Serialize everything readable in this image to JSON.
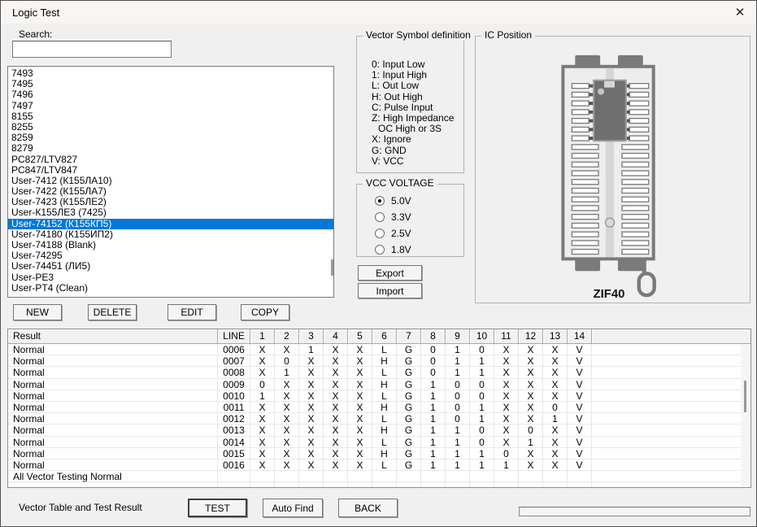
{
  "window": {
    "title": "Logic Test",
    "close_icon": "✕"
  },
  "search": {
    "label": "Search:",
    "value": ""
  },
  "chip_list": {
    "items": [
      "7493",
      "7495",
      "7496",
      "7497",
      "8155",
      "8255",
      "8259",
      "8279",
      "PC827/LTV827",
      "PC847/LTV847",
      "User-7412 (К155ЛА10)",
      "User-7422 (К155ЛА7)",
      "User-7423 (К155ЛЕ2)",
      "User-К155ЛЕ3 (7425)",
      "User-74152 (К155КП5)",
      "User-74180 (К155ИП2)",
      "User-74188 (Blank)",
      "User-74295",
      "User-74451 (ЛИ5)",
      "User-PE3",
      "User-PT4 (Clean)"
    ],
    "selected_index": 14,
    "selected_item": "User-74152 (К155КП5)"
  },
  "list_actions": {
    "new": "NEW",
    "delete": "DELETE",
    "edit": "EDIT",
    "copy": "COPY"
  },
  "vector_symbols": {
    "title": "Vector Symbol definition",
    "lines": [
      "0: Input Low",
      "1: Input High",
      "L: Out Low",
      "H: Out High",
      "C: Pulse Input",
      "Z: High Impedance",
      "OC High or 3S",
      "X: Ignore",
      "G: GND",
      "V: VCC"
    ]
  },
  "vcc": {
    "title": "VCC VOLTAGE",
    "options": [
      {
        "label": "5.0V",
        "selected": true
      },
      {
        "label": "3.3V",
        "selected": false
      },
      {
        "label": "2.5V",
        "selected": false
      },
      {
        "label": "1.8V",
        "selected": false
      }
    ]
  },
  "transfer": {
    "export": "Export",
    "import": "Import"
  },
  "ic_position": {
    "title": "IC Position",
    "socket_label": "ZIF40"
  },
  "vector_table": {
    "headers": [
      "Result",
      "LINE",
      "1",
      "2",
      "3",
      "4",
      "5",
      "6",
      "7",
      "8",
      "9",
      "10",
      "11",
      "12",
      "13",
      "14"
    ],
    "rows": [
      {
        "result": "Normal",
        "line": "0006",
        "values": [
          "X",
          "X",
          "1",
          "X",
          "X",
          "L",
          "G",
          "0",
          "1",
          "0",
          "X",
          "X",
          "X",
          "V"
        ]
      },
      {
        "result": "Normal",
        "line": "0007",
        "values": [
          "X",
          "0",
          "X",
          "X",
          "X",
          "H",
          "G",
          "0",
          "1",
          "1",
          "X",
          "X",
          "X",
          "V"
        ]
      },
      {
        "result": "Normal",
        "line": "0008",
        "values": [
          "X",
          "1",
          "X",
          "X",
          "X",
          "L",
          "G",
          "0",
          "1",
          "1",
          "X",
          "X",
          "X",
          "V"
        ]
      },
      {
        "result": "Normal",
        "line": "0009",
        "values": [
          "0",
          "X",
          "X",
          "X",
          "X",
          "H",
          "G",
          "1",
          "0",
          "0",
          "X",
          "X",
          "X",
          "V"
        ]
      },
      {
        "result": "Normal",
        "line": "0010",
        "values": [
          "1",
          "X",
          "X",
          "X",
          "X",
          "L",
          "G",
          "1",
          "0",
          "0",
          "X",
          "X",
          "X",
          "V"
        ]
      },
      {
        "result": "Normal",
        "line": "0011",
        "values": [
          "X",
          "X",
          "X",
          "X",
          "X",
          "H",
          "G",
          "1",
          "0",
          "1",
          "X",
          "X",
          "0",
          "V"
        ]
      },
      {
        "result": "Normal",
        "line": "0012",
        "values": [
          "X",
          "X",
          "X",
          "X",
          "X",
          "L",
          "G",
          "1",
          "0",
          "1",
          "X",
          "X",
          "1",
          "V"
        ]
      },
      {
        "result": "Normal",
        "line": "0013",
        "values": [
          "X",
          "X",
          "X",
          "X",
          "X",
          "H",
          "G",
          "1",
          "1",
          "0",
          "X",
          "0",
          "X",
          "V"
        ]
      },
      {
        "result": "Normal",
        "line": "0014",
        "values": [
          "X",
          "X",
          "X",
          "X",
          "X",
          "L",
          "G",
          "1",
          "1",
          "0",
          "X",
          "1",
          "X",
          "V"
        ]
      },
      {
        "result": "Normal",
        "line": "0015",
        "values": [
          "X",
          "X",
          "X",
          "X",
          "X",
          "H",
          "G",
          "1",
          "1",
          "1",
          "0",
          "X",
          "X",
          "V"
        ]
      },
      {
        "result": "Normal",
        "line": "0016",
        "values": [
          "X",
          "X",
          "X",
          "X",
          "X",
          "L",
          "G",
          "1",
          "1",
          "1",
          "1",
          "X",
          "X",
          "V"
        ]
      }
    ],
    "summary": "All Vector Testing Normal"
  },
  "footer": {
    "label": "Vector Table and Test Result",
    "test": "TEST",
    "auto_find": "Auto Find",
    "back": "BACK"
  },
  "colors": {
    "selection_bg": "#0078d7",
    "selection_text": "#ffffff",
    "titlebar_bg": "#f8f5f2",
    "socket_gray": "#7a7a7a",
    "chip_gray": "#6f6f6f"
  }
}
